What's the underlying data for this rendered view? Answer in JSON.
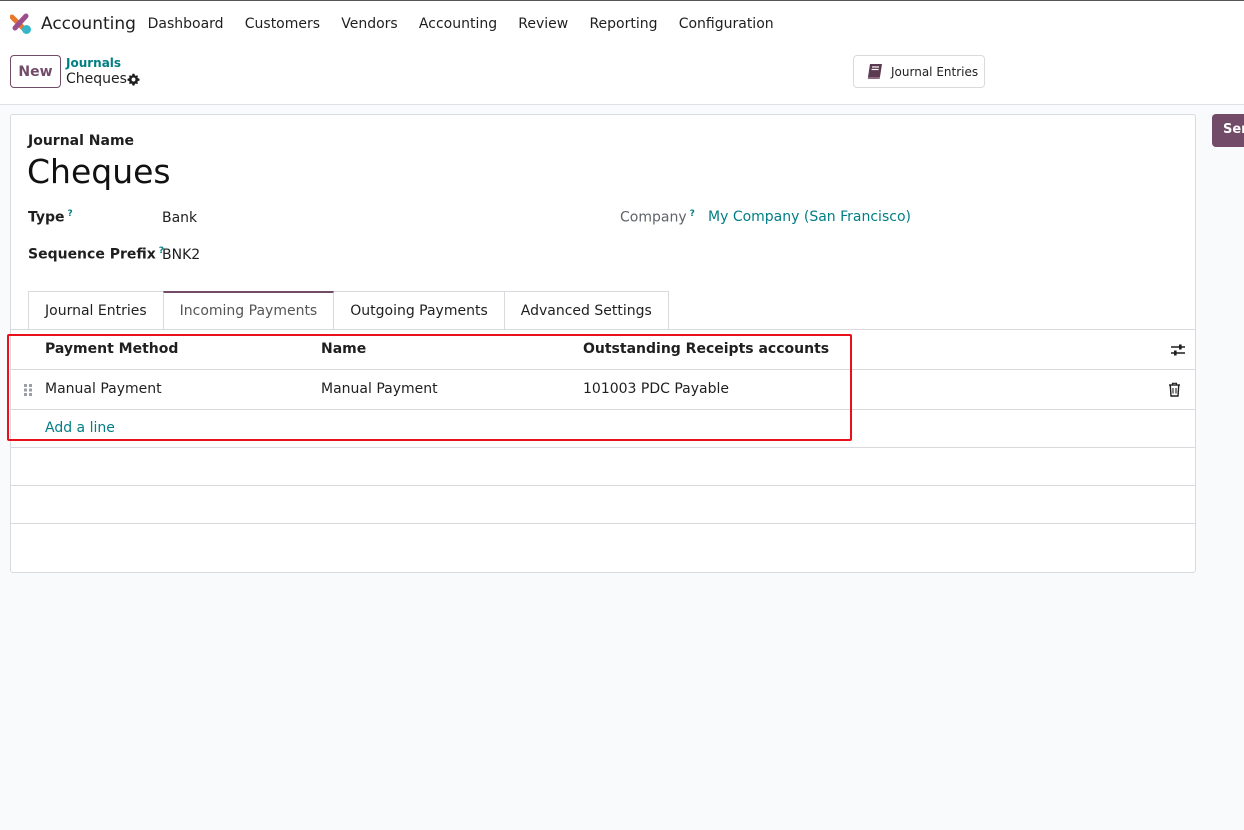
{
  "navbar": {
    "app_name": "Accounting",
    "menu": [
      "Dashboard",
      "Customers",
      "Vendors",
      "Accounting",
      "Review",
      "Reporting",
      "Configuration"
    ]
  },
  "control_panel": {
    "new_label": "New",
    "breadcrumb_parent": "Journals",
    "breadcrumb_current": "Cheques",
    "smart_button_label": "Journal Entries",
    "send_label": "Send"
  },
  "form": {
    "journal_name_label": "Journal Name",
    "journal_name": "Cheques",
    "type_label": "Type",
    "type_value": "Bank",
    "sequence_prefix_label": "Sequence Prefix",
    "sequence_prefix_value": "BNK2",
    "company_label": "Company",
    "company_value": "My Company (San Francisco)",
    "help_mark": "?"
  },
  "tabs": [
    {
      "label": "Journal Entries",
      "active": false
    },
    {
      "label": "Incoming Payments",
      "active": true
    },
    {
      "label": "Outgoing Payments",
      "active": false
    },
    {
      "label": "Advanced Settings",
      "active": false
    }
  ],
  "table": {
    "columns": [
      "Payment Method",
      "Name",
      "Outstanding Receipts accounts"
    ],
    "rows": [
      [
        "Manual Payment",
        "Manual Payment",
        "101003 PDC Payable"
      ]
    ],
    "add_line_label": "Add a line"
  },
  "colors": {
    "brand": "#714b67",
    "link": "#017e84",
    "highlight": "#e8101a"
  }
}
